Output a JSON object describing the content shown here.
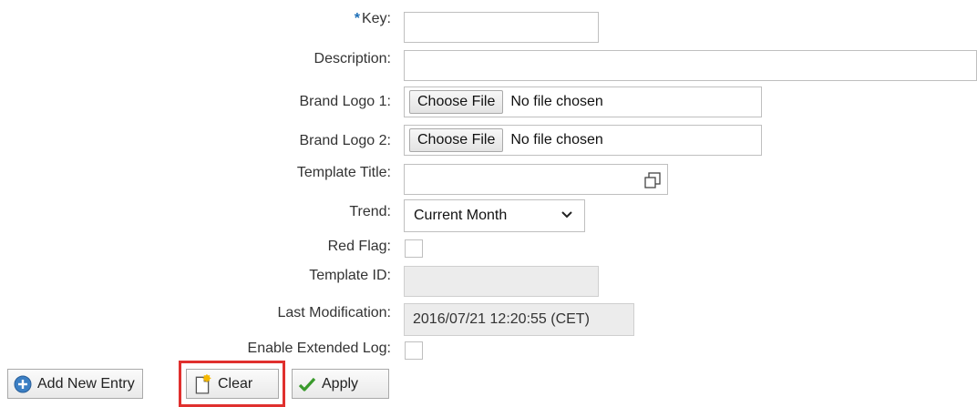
{
  "form": {
    "key_required_marker": "*",
    "key_label": "Key:",
    "key_value": "",
    "description_label": "Description:",
    "description_value": "",
    "brand_logo_1_label": "Brand Logo 1:",
    "brand_logo_1_button": "Choose File",
    "brand_logo_1_status": "No file chosen",
    "brand_logo_2_label": "Brand Logo 2:",
    "brand_logo_2_button": "Choose File",
    "brand_logo_2_status": "No file chosen",
    "template_title_label": "Template Title:",
    "template_title_value": "",
    "template_title_icon": "expand-window-icon",
    "trend_label": "Trend:",
    "trend_selected": "Current Month",
    "red_flag_label": "Red Flag:",
    "red_flag_checked": false,
    "template_id_label": "Template ID:",
    "template_id_value": "",
    "last_modification_label": "Last Modification:",
    "last_modification_value": "2016/07/21 12:20:55 (CET)",
    "enable_extended_log_label": "Enable Extended Log:",
    "enable_extended_log_checked": false
  },
  "toolbar": {
    "add_new_entry_label": "Add New Entry",
    "add_new_entry_icon": "plus-circle-icon",
    "clear_label": "Clear",
    "clear_icon": "new-document-icon",
    "apply_label": "Apply",
    "apply_icon": "checkmark-icon"
  },
  "colors": {
    "required_marker": "#1d6fb8",
    "highlight_border": "#e0302e",
    "apply_check": "#3a9a2c",
    "add_icon": "#3b7fc4"
  }
}
